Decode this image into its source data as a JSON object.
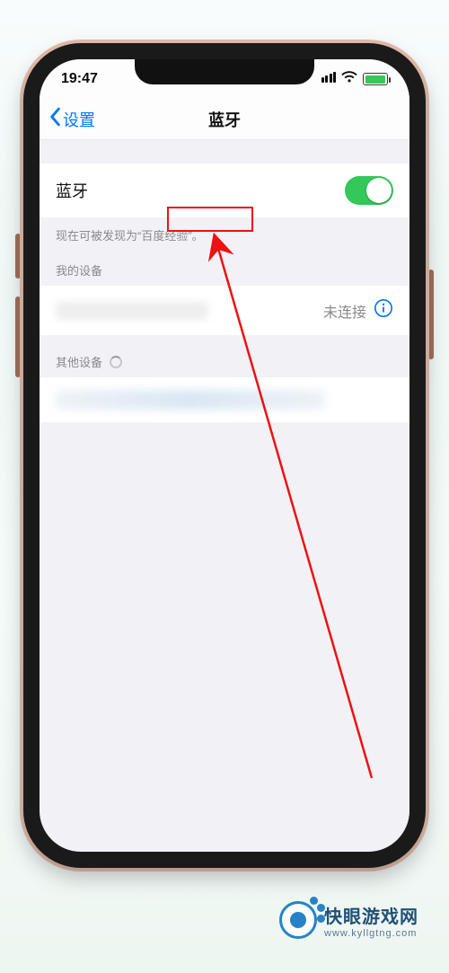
{
  "statusbar": {
    "time": "19:47"
  },
  "navbar": {
    "back_label": "设置",
    "title": "蓝牙"
  },
  "main": {
    "toggle_label": "蓝牙",
    "hint_text": "现在可被发现为“百度经验”。"
  },
  "sections": {
    "my_devices_header": "我的设备",
    "other_devices_header": "其他设备",
    "device_status_label": "未连接"
  },
  "watermark": {
    "title": "快眼游戏网",
    "url": "www.kyllgtng.com"
  }
}
